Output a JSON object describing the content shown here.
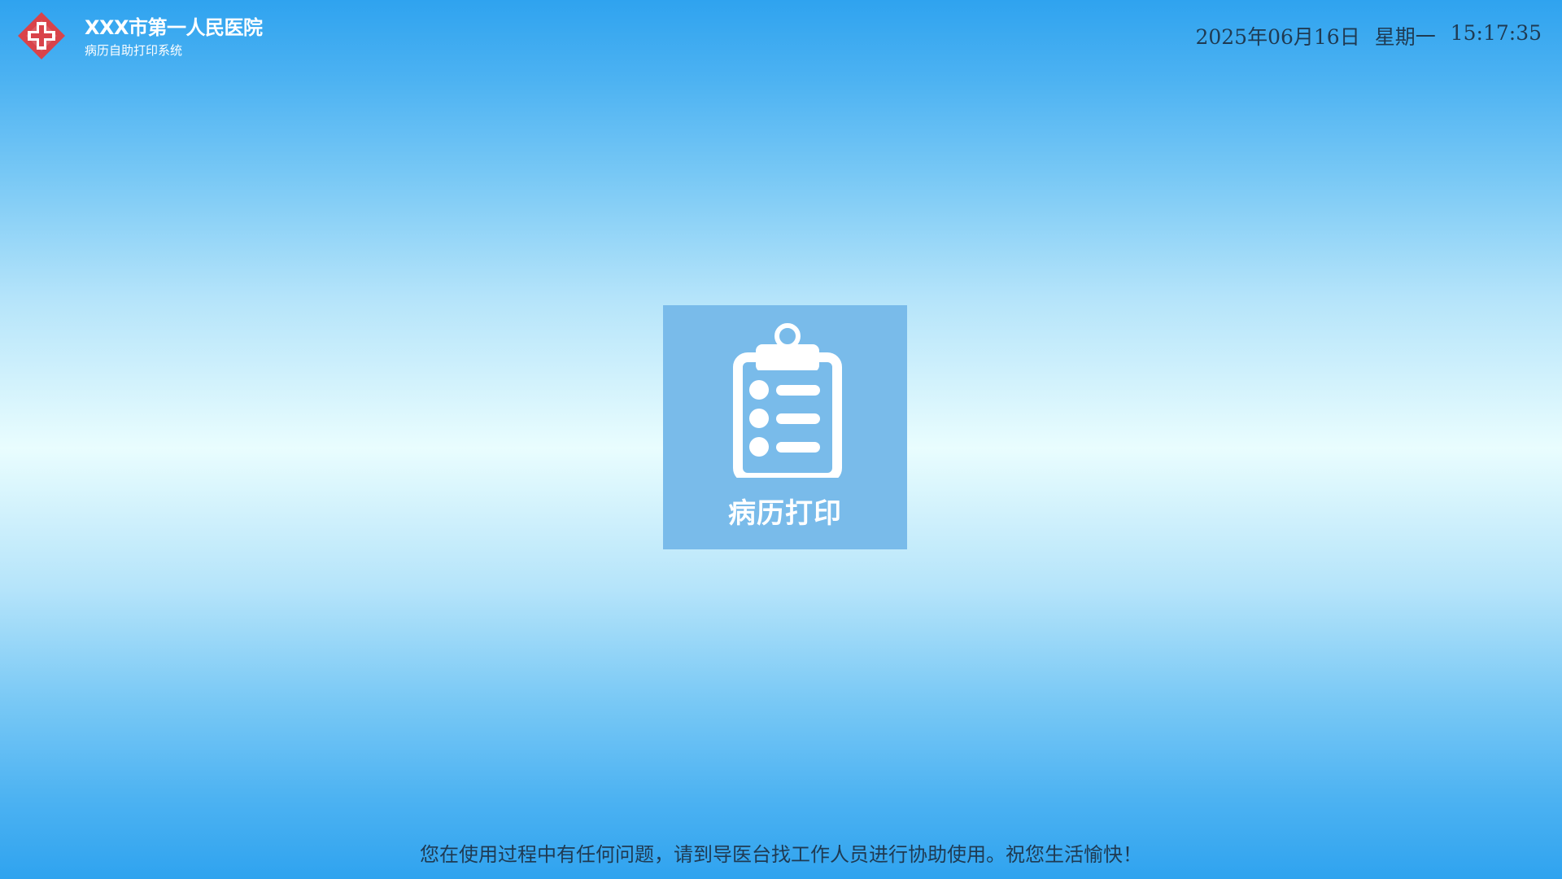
{
  "header": {
    "hospital_name": "XXX市第一人民医院",
    "system_name": "病历自助打印系统",
    "logo_icon": "red-cross-icon",
    "logo_color": "#d9434a"
  },
  "datetime": {
    "date": "2025年06月16日",
    "weekday": "星期一",
    "time": "15:17:35"
  },
  "main": {
    "tile": {
      "label": "病历打印",
      "icon": "clipboard-list-icon",
      "background": "#79bbea"
    }
  },
  "footer": {
    "notice": "您在使用过程中有任何问题，请到导医台找工作人员进行协助使用。祝您生活愉快！"
  }
}
